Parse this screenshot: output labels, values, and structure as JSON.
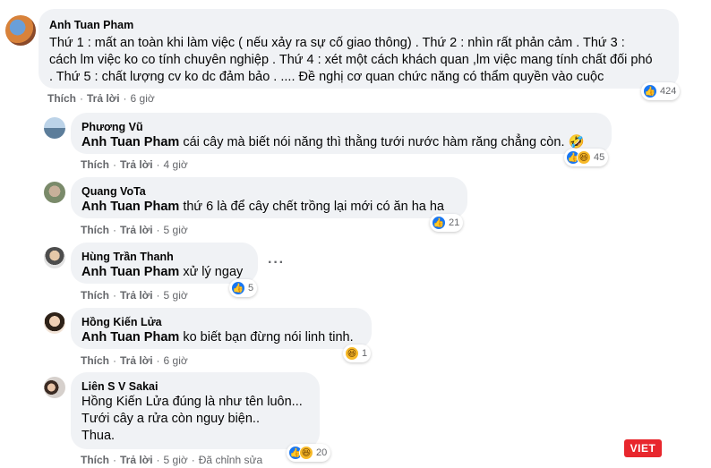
{
  "comments": [
    {
      "author": "Anh Tuan Pham",
      "lines": [
        "Thứ 1 : mất an toàn khi làm việc ( nếu xảy ra sự cố giao thông) . Thứ 2 : nhìn rất phản cảm . Thứ 3 :",
        "cách lm việc ko co tính chuyên nghiệp . Thứ 4 : xét một cách khách quan ,lm việc mang tính chất đối phó",
        ". Thứ 5 : chất lượng cv ko dc đảm bảo . .... Đề nghị cơ quan chức năng có thẩm quyền vào cuộc"
      ],
      "like_label": "Thích",
      "reply_label": "Trả lời",
      "time": "6 giờ",
      "reaction_count": "424"
    },
    {
      "author": "Phương Vũ",
      "mention": "Anh Tuan Pham",
      "text": " cái cây mà biết nói năng thì thằng tưới nước hàm răng chẳng còn. 🤣",
      "like_label": "Thích",
      "reply_label": "Trả lời",
      "time": "4 giờ",
      "reaction_count": "45"
    },
    {
      "author": "Quang VoTa",
      "mention": "Anh Tuan Pham",
      "text": " thứ 6 là để cây chết trồng lại mới có ăn ha ha",
      "like_label": "Thích",
      "reply_label": "Trả lời",
      "time": "5 giờ",
      "reaction_count": "21"
    },
    {
      "author": "Hùng Trần Thanh",
      "mention": "Anh Tuan Pham",
      "text": " xử lý ngay",
      "like_label": "Thích",
      "reply_label": "Trả lời",
      "time": "5 giờ",
      "reaction_count": "5"
    },
    {
      "author": "Hồng Kiến Lửa",
      "mention": "Anh Tuan Pham",
      "text": " ko biết bạn đừng nói linh tinh.",
      "like_label": "Thích",
      "reply_label": "Trả lời",
      "time": "6 giờ",
      "reaction_count": "1"
    },
    {
      "author": "Liên S V Sakai",
      "lines": [
        "Hồng Kiến Lửa đúng là như tên luôn...",
        "Tưới cây a rửa còn nguy biện..",
        "Thua."
      ],
      "like_label": "Thích",
      "reply_label": "Trả lời",
      "time": "5 giờ",
      "edited_label": "Đã chỉnh sửa",
      "reaction_count": "20"
    }
  ],
  "more_options": "···",
  "watermark": "VIET",
  "icons": {
    "like": "like-icon",
    "haha": "haha-icon"
  },
  "colors": {
    "bubble": "#f0f2f5",
    "like_blue": "#1877f2",
    "haha_yellow": "#f7b928",
    "meta_gray": "#65676b",
    "watermark_red": "#e8272d"
  }
}
